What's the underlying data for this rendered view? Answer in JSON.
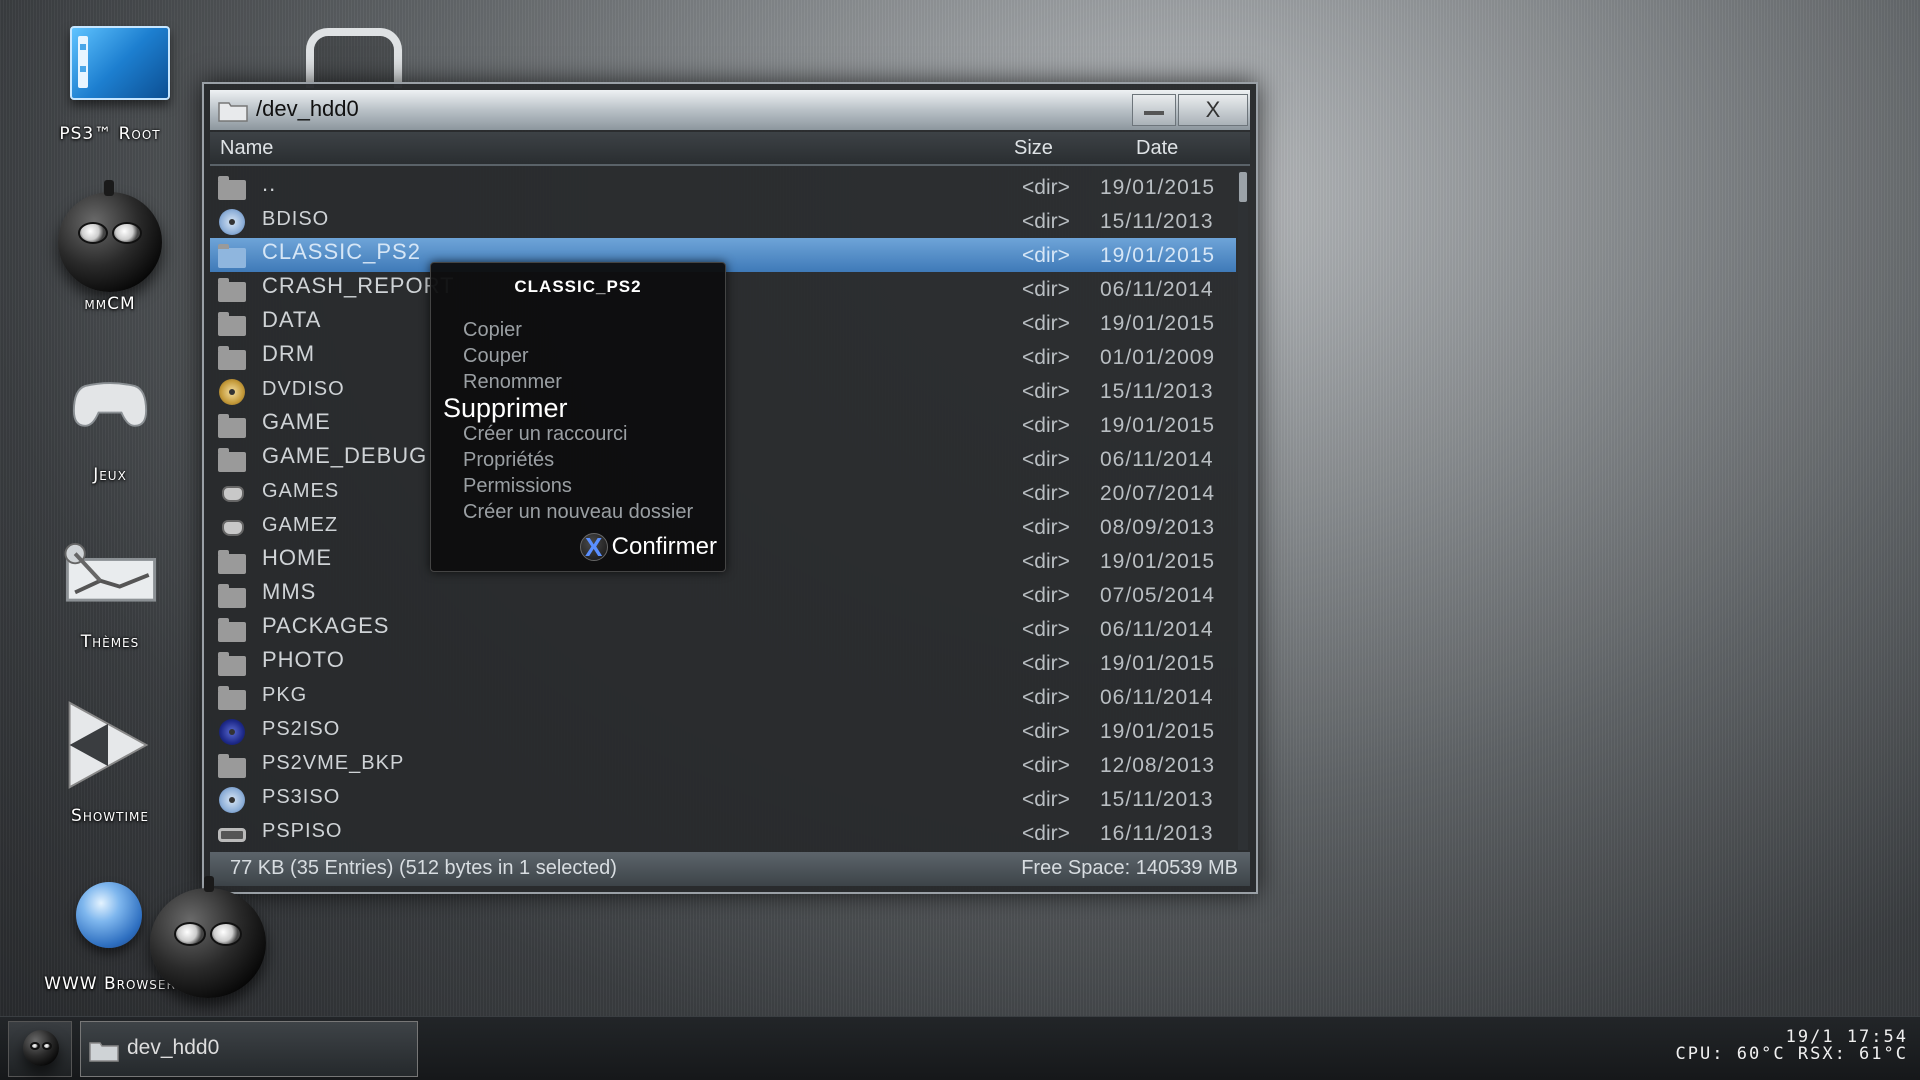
{
  "desktop": {
    "icons": [
      {
        "label": "PS3™ Root"
      },
      {
        "label": "mmCM"
      },
      {
        "label": "Jeux"
      },
      {
        "label": "Thèmes"
      },
      {
        "label": "Showtime"
      },
      {
        "label": "WWW Browser"
      }
    ]
  },
  "window": {
    "title": "/dev_hdd0",
    "close_label": "X",
    "columns": {
      "name": "Name",
      "size": "Size",
      "date": "Date"
    },
    "rows": [
      {
        "name": "..",
        "size": "<dir>",
        "date": "19/01/2015",
        "icon": "folder-icon"
      },
      {
        "name": "BDISO",
        "size": "<dir>",
        "date": "15/11/2013",
        "icon": "bd-disc-icon"
      },
      {
        "name": "CLASSIC_PS2",
        "size": "<dir>",
        "date": "19/01/2015",
        "icon": "folder-icon",
        "selected": true
      },
      {
        "name": "CRASH_REPORT",
        "size": "<dir>",
        "date": "06/11/2014",
        "icon": "folder-icon"
      },
      {
        "name": "DATA",
        "size": "<dir>",
        "date": "19/01/2015",
        "icon": "folder-icon"
      },
      {
        "name": "DRM",
        "size": "<dir>",
        "date": "01/01/2009",
        "icon": "folder-icon"
      },
      {
        "name": "DVDISO",
        "size": "<dir>",
        "date": "15/11/2013",
        "icon": "dvd-disc-icon"
      },
      {
        "name": "GAME",
        "size": "<dir>",
        "date": "19/01/2015",
        "icon": "folder-icon"
      },
      {
        "name": "GAME_DEBUG",
        "size": "<dir>",
        "date": "06/11/2014",
        "icon": "folder-icon"
      },
      {
        "name": "GAMES",
        "size": "<dir>",
        "date": "20/07/2014",
        "icon": "gamepad-icon"
      },
      {
        "name": "GAMEZ",
        "size": "<dir>",
        "date": "08/09/2013",
        "icon": "gamepad-icon"
      },
      {
        "name": "HOME",
        "size": "<dir>",
        "date": "19/01/2015",
        "icon": "folder-icon"
      },
      {
        "name": "MMS",
        "size": "<dir>",
        "date": "07/05/2014",
        "icon": "folder-icon"
      },
      {
        "name": "PACKAGES",
        "size": "<dir>",
        "date": "06/11/2014",
        "icon": "folder-icon"
      },
      {
        "name": "PHOTO",
        "size": "<dir>",
        "date": "19/01/2015",
        "icon": "folder-icon"
      },
      {
        "name": "PKG",
        "size": "<dir>",
        "date": "06/11/2014",
        "icon": "folder-icon"
      },
      {
        "name": "PS2ISO",
        "size": "<dir>",
        "date": "19/01/2015",
        "icon": "ps2-disc-icon"
      },
      {
        "name": "PS2VME_BKP",
        "size": "<dir>",
        "date": "12/08/2013",
        "icon": "folder-icon"
      },
      {
        "name": "PS3ISO",
        "size": "<dir>",
        "date": "15/11/2013",
        "icon": "ps3-disc-icon"
      },
      {
        "name": "PSPISO",
        "size": "<dir>",
        "date": "16/11/2013",
        "icon": "psp-icon"
      }
    ],
    "status_left": "77 KB (35 Entries) (512 bytes in 1 selected)",
    "status_right": "Free Space: 140539 MB"
  },
  "context_menu": {
    "title": "CLASSIC_PS2",
    "items": [
      "Copier",
      "Couper",
      "Renommer",
      "Supprimer",
      "Créer un raccourci",
      "Propriétés",
      "Permissions",
      "Créer un nouveau dossier"
    ],
    "active_index": 3,
    "confirm_label": "Confirmer",
    "confirm_button_glyph": "X"
  },
  "taskbar": {
    "task_label": "dev_hdd0",
    "clock": "19/1 17:54",
    "temps": "CPU: 60°C RSX: 61°C"
  },
  "colors": {
    "selection": "#4f89c6",
    "confirm_x": "#5a8fff"
  }
}
